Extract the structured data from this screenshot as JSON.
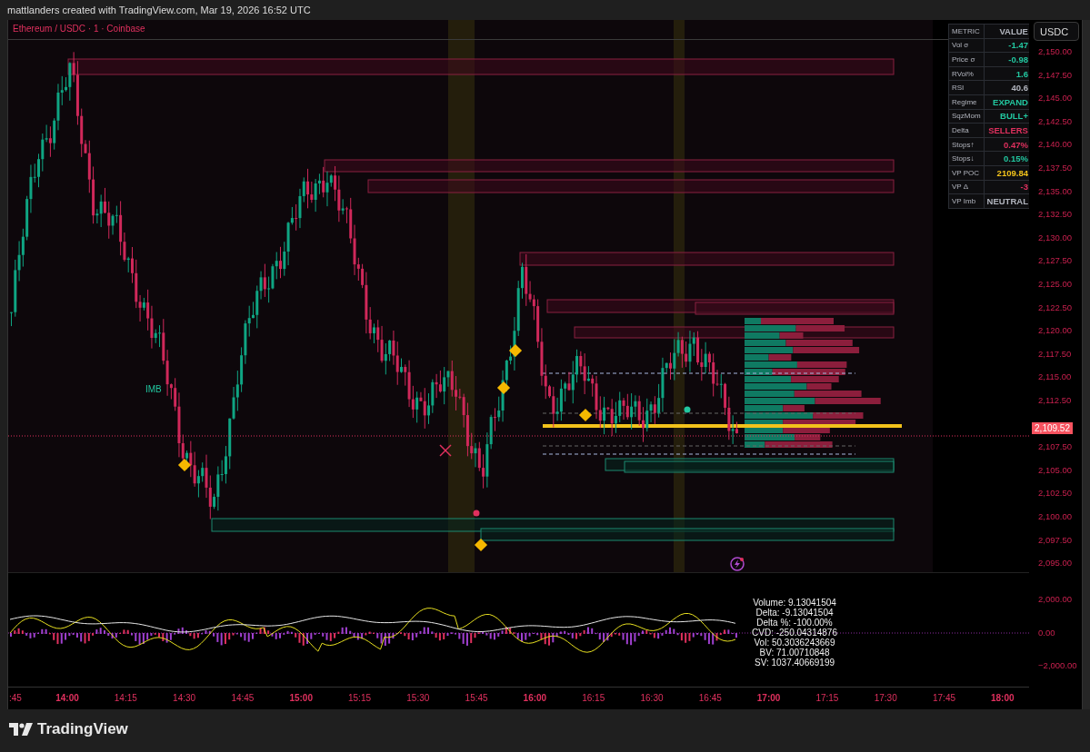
{
  "header": "mattlanders created with TradingView.com, Mar 19, 2026 16:52 UTC",
  "chart": {
    "title": "Ethereum / USDC · 1 · Coinbase",
    "marker_label": "IMB"
  },
  "metrics_table": {
    "columns": [
      "METRIC",
      "VALUE"
    ],
    "rows": [
      {
        "metric": "Vol σ",
        "value": "-1.47",
        "color": "#22c7a0"
      },
      {
        "metric": "Price σ",
        "value": "-0.98",
        "color": "#22c7a0"
      },
      {
        "metric": "RVol%",
        "value": "1.6",
        "color": "#22c7a0"
      },
      {
        "metric": "RSI",
        "value": "40.6",
        "color": "#b2b5be"
      },
      {
        "metric": "Regime",
        "value": "EXPAND",
        "color": "#22c7a0"
      },
      {
        "metric": "SqzMom",
        "value": "BULL+",
        "color": "#22c7a0"
      },
      {
        "metric": "Delta",
        "value": "SELLERS",
        "color": "#e0305e"
      },
      {
        "metric": "Stops↑",
        "value": "0.47%",
        "color": "#e0305e"
      },
      {
        "metric": "Stops↓",
        "value": "0.15%",
        "color": "#22c7a0"
      },
      {
        "metric": "VP POC",
        "value": "2109.84",
        "color": "#f2c21b"
      },
      {
        "metric": "VP Δ",
        "value": "-3",
        "color": "#e0305e"
      },
      {
        "metric": "VP Imb",
        "value": "NEUTRAL",
        "color": "#b2b5be"
      }
    ]
  },
  "currency_button": "USDC",
  "price_axis": [
    "2,150.00",
    "2,147.50",
    "2,145.00",
    "2,142.50",
    "2,140.00",
    "2,137.50",
    "2,135.00",
    "2,132.50",
    "2,130.00",
    "2,127.50",
    "2,125.00",
    "2,122.50",
    "2,120.00",
    "2,117.50",
    "2,115.00",
    "2,112.50",
    "2,107.50",
    "2,105.00",
    "2,102.50",
    "2,100.00",
    "2,097.50",
    "2,095.00"
  ],
  "last_price": "2,109.52",
  "indicator_axis": [
    "2,000.00",
    "0.00",
    "−2,000.00"
  ],
  "info_lines": [
    "Volume: 9.13041504",
    "Delta: -9.13041504",
    "Delta %: -100.00%",
    "CVD: -250.04314876",
    "Vol: 50.3036243669",
    "BV: 71.00710848",
    "SV: 1037.40669199"
  ],
  "time_axis": [
    {
      "label": ":45",
      "kind": "minor"
    },
    {
      "label": "14:00",
      "kind": "hour"
    },
    {
      "label": "14:15",
      "kind": "minor"
    },
    {
      "label": "14:30",
      "kind": "minor"
    },
    {
      "label": "14:45",
      "kind": "minor"
    },
    {
      "label": "15:00",
      "kind": "hour"
    },
    {
      "label": "15:15",
      "kind": "minor"
    },
    {
      "label": "15:30",
      "kind": "minor"
    },
    {
      "label": "15:45",
      "kind": "minor"
    },
    {
      "label": "16:00",
      "kind": "hour"
    },
    {
      "label": "16:15",
      "kind": "minor"
    },
    {
      "label": "16:30",
      "kind": "minor"
    },
    {
      "label": "16:45",
      "kind": "minor"
    },
    {
      "label": "17:00",
      "kind": "hour"
    },
    {
      "label": "17:15",
      "kind": "minor"
    },
    {
      "label": "17:30",
      "kind": "minor"
    },
    {
      "label": "17:45",
      "kind": "minor"
    },
    {
      "label": "18:00",
      "kind": "hour"
    }
  ],
  "brand": "TradingView"
}
